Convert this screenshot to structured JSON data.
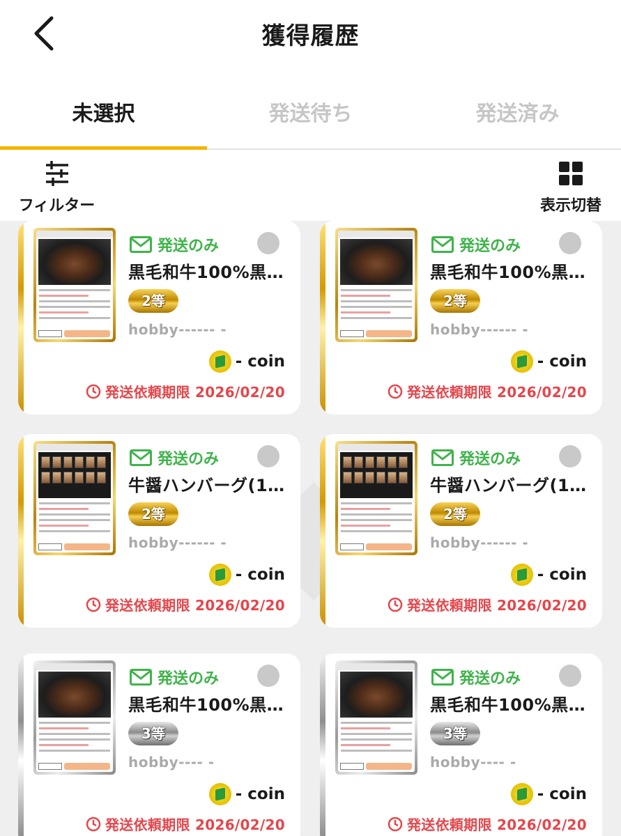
{
  "header": {
    "title": "獲得履歴"
  },
  "tabs": [
    {
      "label": "未選択",
      "active": true
    },
    {
      "label": "発送待ち",
      "active": false
    },
    {
      "label": "発送済み",
      "active": false
    }
  ],
  "toolbar": {
    "filter_label": "フィルター",
    "view_label": "表示切替"
  },
  "colors": {
    "accent": "#f3b400",
    "ship": "#3fb34a",
    "deadline": "#e5464b"
  },
  "items": [
    {
      "ship": "発送のみ",
      "name": "黒毛和牛100%黒…",
      "rank": "2等",
      "rank_type": "gold",
      "user": "hobby------ -",
      "coin": "- coin",
      "deadline": "発送依頼期限 2026/02/20"
    },
    {
      "ship": "発送のみ",
      "name": "黒毛和牛100%黒…",
      "rank": "2等",
      "rank_type": "gold",
      "user": "hobby------ -",
      "coin": "- coin",
      "deadline": "発送依頼期限 2026/02/20"
    },
    {
      "ship": "発送のみ",
      "name": "牛醤ハンバーグ(1…",
      "rank": "2等",
      "rank_type": "gold",
      "user": "hobby------ -",
      "coin": "- coin",
      "deadline": "発送依頼期限 2026/02/20"
    },
    {
      "ship": "発送のみ",
      "name": "牛醤ハンバーグ(1…",
      "rank": "2等",
      "rank_type": "gold",
      "user": "hobby------ -",
      "coin": "- coin",
      "deadline": "発送依頼期限 2026/02/20"
    },
    {
      "ship": "発送のみ",
      "name": "黒毛和牛100%黒…",
      "rank": "3等",
      "rank_type": "silver",
      "user": "hobby---- -",
      "coin": "- coin",
      "deadline": "発送依頼期限 2026/02/20"
    },
    {
      "ship": "発送のみ",
      "name": "黒毛和牛100%黒…",
      "rank": "3等",
      "rank_type": "silver",
      "user": "hobby---- -",
      "coin": "- coin",
      "deadline": "発送依頼期限 2026/02/20"
    }
  ]
}
